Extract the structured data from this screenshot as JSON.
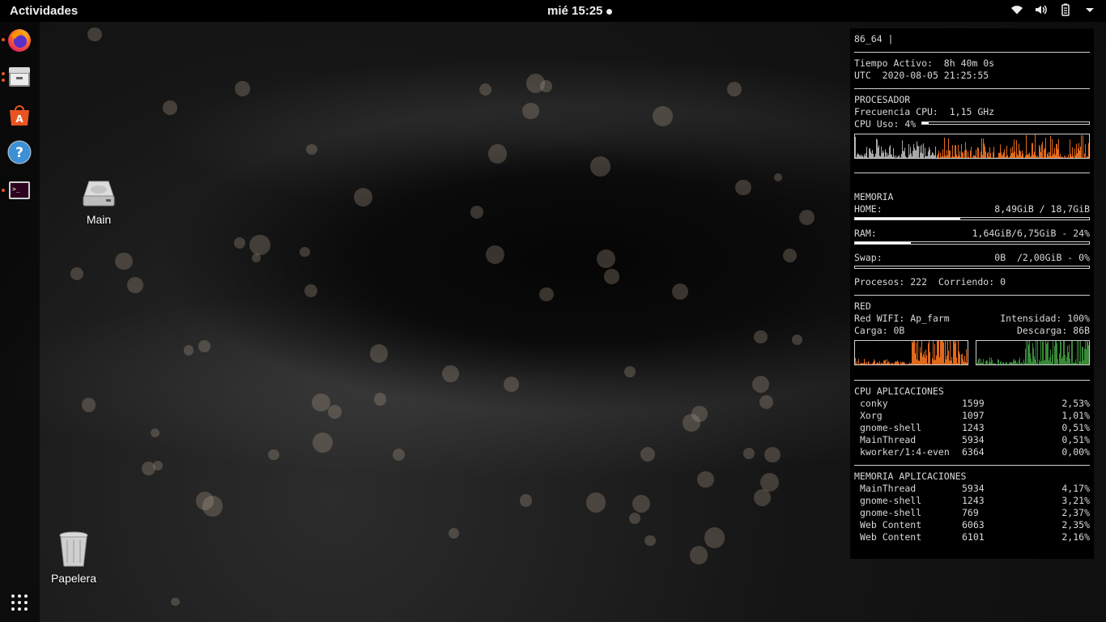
{
  "topbar": {
    "activities": "Actividades",
    "clock": "mié 15:25",
    "tray_icons": [
      "wifi-icon",
      "volume-icon",
      "battery-icon",
      "menu-arrow-icon"
    ]
  },
  "dock": {
    "items": [
      "firefox",
      "files",
      "software-center",
      "help",
      "terminal"
    ],
    "running": [
      "firefox",
      "files",
      "terminal"
    ],
    "accent": "#e95420"
  },
  "desktop": {
    "main_label": "Main",
    "trash_label": "Papelera"
  },
  "conky": {
    "kernel": "86_64 |",
    "uptime_label": "Tiempo Activo:",
    "uptime_value": "8h 40m 0s",
    "utc_label": "UTC",
    "utc_value": "2020-08-05 21:25:55",
    "cpu_title": "PROCESADOR",
    "cpu_freq_label": "Frecuencia CPU:",
    "cpu_freq_value": "1,15 GHz",
    "cpu_usage_label": "CPU Uso:",
    "cpu_usage_value": "4%",
    "cpu_usage_fraction": 0.04,
    "mem_title": "MEMORIA",
    "home_label": "HOME:",
    "home_value": "8,49GiB / 18,7GiB",
    "home_fraction": 0.45,
    "ram_label": "RAM:",
    "ram_value": "1,64GiB/6,75GiB - 24%",
    "ram_fraction": 0.24,
    "swap_label": "Swap:",
    "swap_value": "0B  /2,00GiB - 0%",
    "swap_fraction": 0,
    "procs_label": "Procesos:",
    "procs_value": "222",
    "running_label": "Corriendo:",
    "running_value": "0",
    "net_title": "RED",
    "wifi_label": "Red WIFI:",
    "wifi_value": "Ap_farm",
    "signal_label": "Intensidad:",
    "signal_value": "100%",
    "up_label": "Carga:",
    "up_value": "0B",
    "down_label": "Descarga:",
    "down_value": "86B",
    "cpu_apps_title": "CPU APLICACIONES",
    "cpu_apps": [
      {
        "name": "conky",
        "pid": "1599",
        "value": "2,53%"
      },
      {
        "name": "Xorg",
        "pid": "1097",
        "value": "1,01%"
      },
      {
        "name": "gnome-shell",
        "pid": "1243",
        "value": "0,51%"
      },
      {
        "name": "MainThread",
        "pid": "5934",
        "value": "0,51%"
      },
      {
        "name": "kworker/1:4-even",
        "pid": "6364",
        "value": "0,00%"
      }
    ],
    "mem_apps_title": "MEMORIA APLICACIONES",
    "mem_apps": [
      {
        "name": "MainThread",
        "pid": "5934",
        "value": "4,17%"
      },
      {
        "name": "gnome-shell",
        "pid": "1243",
        "value": "3,21%"
      },
      {
        "name": "gnome-shell",
        "pid": "769",
        "value": "2,37%"
      },
      {
        "name": "Web Content",
        "pid": "6063",
        "value": "2,35%"
      },
      {
        "name": "Web Content",
        "pid": "6101",
        "value": "2,16%"
      }
    ],
    "graph_colors": {
      "cpu_old": "#a8a8a8",
      "cpu_new": "#e06a1c",
      "upload": "#e06a1c",
      "download": "#3a8a3a"
    }
  }
}
